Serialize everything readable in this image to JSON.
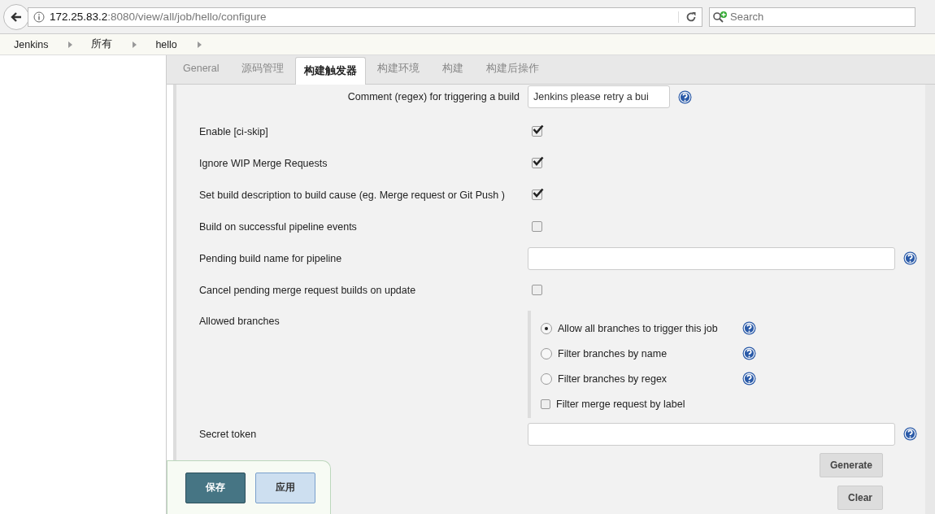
{
  "browser": {
    "url_host": "172.25.83.2",
    "url_rest": ":8080/view/all/job/hello/configure",
    "search_placeholder": "Search"
  },
  "breadcrumbs": [
    "Jenkins",
    "所有",
    "hello"
  ],
  "tabs": [
    {
      "label": "General",
      "selected": false
    },
    {
      "label": "源码管理",
      "selected": false
    },
    {
      "label": "构建触发器",
      "selected": true
    },
    {
      "label": "构建环境",
      "selected": false
    },
    {
      "label": "构建",
      "selected": false
    },
    {
      "label": "构建后操作",
      "selected": false
    }
  ],
  "fields": [
    {
      "kind": "text",
      "label": "Comment (regex) for triggering a build",
      "value": "Jenkins please retry a bui",
      "help": true
    },
    {
      "kind": "checkbox",
      "label": "Enable [ci-skip]",
      "checked": true
    },
    {
      "kind": "checkbox",
      "label": "Ignore WIP Merge Requests",
      "checked": true
    },
    {
      "kind": "checkbox",
      "label": "Set build description to build cause (eg. Merge request or Git Push )",
      "checked": true
    },
    {
      "kind": "checkbox",
      "label": "Build on successful pipeline events",
      "checked": false
    },
    {
      "kind": "text",
      "label": "Pending build name for pipeline",
      "help": true
    },
    {
      "kind": "checkbox",
      "label": "Cancel pending merge request builds on update",
      "checked": false
    },
    {
      "kind": "options",
      "label": "Allowed branches",
      "options": [
        {
          "kind": "radio",
          "label": "Allow all branches to trigger this job",
          "selected": true,
          "help": true
        },
        {
          "kind": "radio",
          "label": "Filter branches by name",
          "selected": false,
          "help": true
        },
        {
          "kind": "radio",
          "label": "Filter branches by regex",
          "selected": false,
          "help": true
        },
        {
          "kind": "checkbox",
          "label": "Filter merge request by label",
          "checked": false
        }
      ]
    },
    {
      "kind": "token",
      "label": "Secret token",
      "help": true,
      "buttons": [
        "Generate",
        "Clear"
      ]
    }
  ],
  "actions": [
    {
      "label": "保存",
      "primary": true
    },
    {
      "label": "应用",
      "primary": false
    }
  ]
}
